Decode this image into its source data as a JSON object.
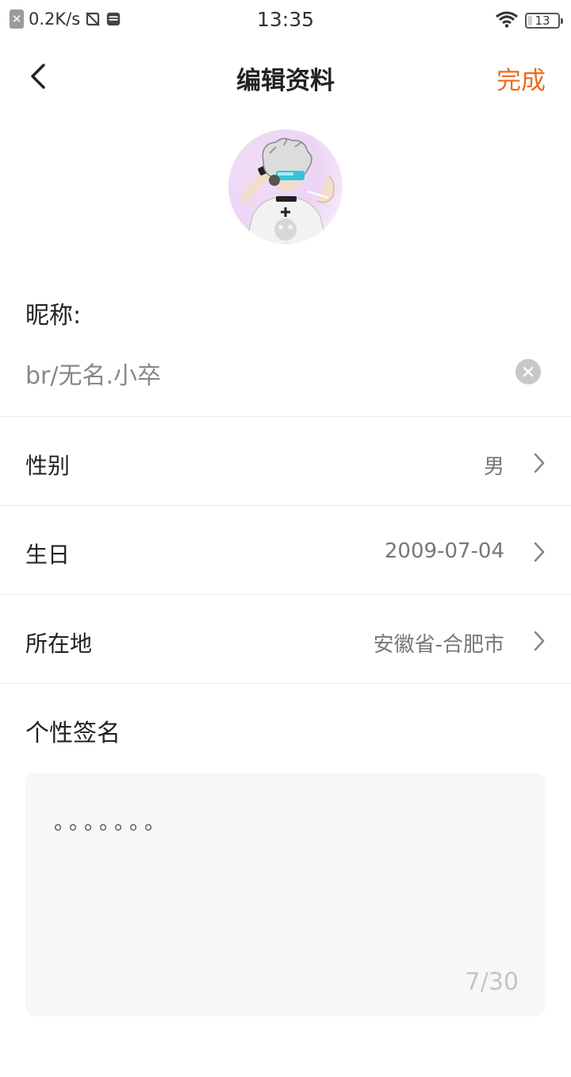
{
  "status_bar": {
    "network_speed": "0.2K/s",
    "time": "13:35",
    "battery_percent": "13",
    "battery_level": 0.13,
    "icons": [
      "close-square-icon",
      "no-signal-icon",
      "sim-card-icon",
      "wifi-icon",
      "battery-icon"
    ]
  },
  "header": {
    "title": "编辑资料",
    "done_label": "完成",
    "accent_color": "#f06a1d"
  },
  "nickname": {
    "label": "昵称:",
    "value": "br/无名.小卒"
  },
  "rows": [
    {
      "label": "性别",
      "value": "男"
    },
    {
      "label": "生日",
      "value": "2009-07-04"
    },
    {
      "label": "所在地",
      "value": "安徽省-合肥市"
    }
  ],
  "signature": {
    "label": "个性签名",
    "value": "。。。。。。。",
    "counter": "7/30"
  }
}
